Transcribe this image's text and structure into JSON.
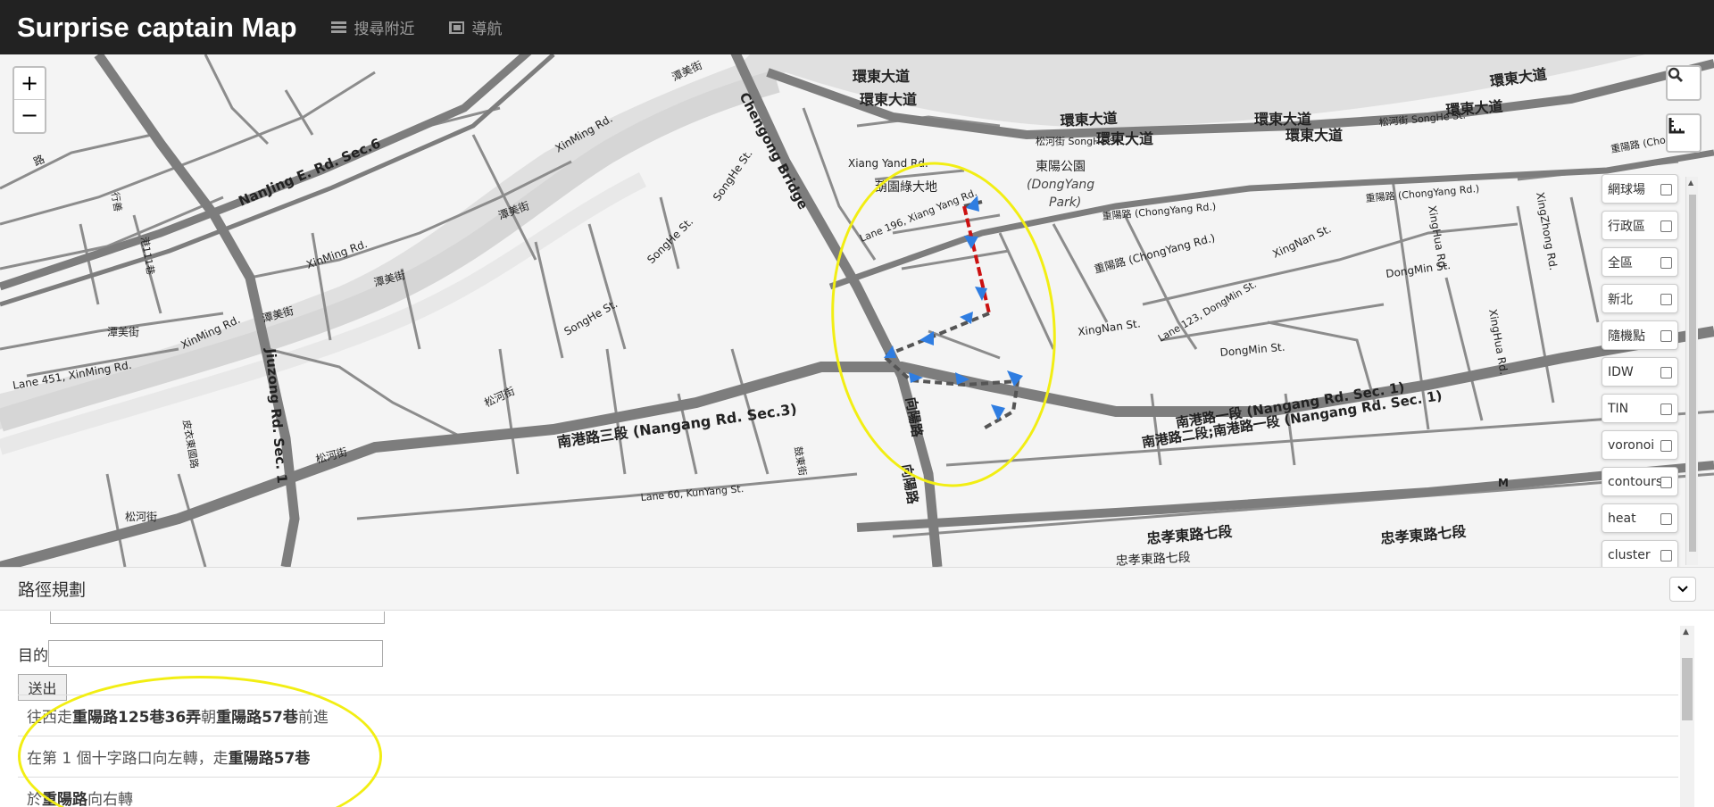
{
  "app": {
    "title": "Surprise captain Map",
    "nav": [
      {
        "label": "搜尋附近",
        "icon": "list-icon"
      },
      {
        "label": "導航",
        "icon": "flag-icon"
      }
    ]
  },
  "map": {
    "zoom_in": "+",
    "zoom_out": "−",
    "labels": {
      "l1": "環東大道",
      "l2": "環東大道",
      "l3": "環東大道",
      "l4": "環東大道",
      "l5": "環東大道",
      "l6": "環東大道",
      "l7": "環東大道",
      "l8": "環東大道",
      "l9": "NanJing E. Rd. Sec.6",
      "l10": "XinMing Rd.",
      "l11": "XinMing Rd.",
      "l12": "XinMing Rd.",
      "l13": "潭美街",
      "l14": "潭美街",
      "l15": "潭美街",
      "l16": "潭美街",
      "l17": "潭美街",
      "l18": "Chengong Bridge",
      "l19": "SongHe St.",
      "l20": "SongHe St.",
      "l21": "SongHe St.",
      "l22": "Jiuzong Rd. Sec. 1",
      "l23": "Lane 451, XinMing Rd.",
      "l24": "松河街",
      "l25": "松河街",
      "l26": "松河街",
      "l27": "南港路三段 (Nangang Rd. Sec.3)",
      "l28": "Lane 60, KunYang St.",
      "l29": "向陽路",
      "l30": "向陽路",
      "l31": "Xiang Yand Rd.",
      "l32": "Lane 196, Xiang Yang Rd.",
      "l33": "葫園綠大地",
      "l34": "東陽公園",
      "l35": "(DongYang",
      "l36": "Park)",
      "l37": "重陽路 (ChongYang Rd.)",
      "l38": "重陽路 (ChongYang Rd.)",
      "l39": "XingNan St.",
      "l40": "XingNan St.",
      "l41": "Lane 123, DongMin St.",
      "l42": "DongMin St.",
      "l43": "DongMin St.",
      "l44": "南港路一段 (Nangang Rd. Sec. 1)",
      "l45": "南港路二段;南港路一段 (Nangang Rd. Sec. 1)",
      "l46": "忠孝東路七段",
      "l47": "忠孝東路七段",
      "l48": "XingHua Rd.",
      "l49": "XingHua Rd.",
      "l50": "XingZhong Rd.",
      "l51": "松河街 SongHe St.",
      "l52": "松河街 SongHe St.",
      "l53": "重陽路 (ChongYang Rd.)",
      "l54": "M",
      "l55": "路",
      "l56": "行善",
      "l57": "港111巷",
      "l58": "重陽路 (Chong",
      "l59": "忠孝東路七段",
      "l60": "鼓東街",
      "l61": "皮衣東國路"
    },
    "layers": [
      {
        "label": "網球場",
        "checked": false
      },
      {
        "label": "行政區",
        "checked": false
      },
      {
        "label": "全區",
        "checked": false
      },
      {
        "label": "新北",
        "checked": false
      },
      {
        "label": "隨機點",
        "checked": false
      },
      {
        "label": "IDW",
        "checked": false
      },
      {
        "label": "TIN",
        "checked": false
      },
      {
        "label": "voronoi",
        "checked": false
      },
      {
        "label": "contours",
        "checked": false
      },
      {
        "label": "heat",
        "checked": false
      },
      {
        "label": "cluster",
        "checked": false
      }
    ],
    "colors": {
      "route": "#555555",
      "route_highlight": "#cc1111",
      "arrow": "#2f7de1",
      "annotation": "#f2ee13"
    }
  },
  "panel": {
    "title": "路徑規劃",
    "dest_label": "目的",
    "dest_value": "",
    "submit_label": "送出",
    "steps": [
      {
        "pre": "往西走",
        "b1": "重陽路125巷36弄",
        "mid": "朝",
        "b2": "重陽路57巷",
        "post": "前進"
      },
      {
        "pre": "在第 1 個十字路口向左轉，走",
        "b1": "重陽路57巷",
        "mid": "",
        "b2": "",
        "post": ""
      },
      {
        "pre": "於",
        "b1": "重陽路",
        "mid": "向右轉",
        "b2": "",
        "post": ""
      }
    ]
  }
}
